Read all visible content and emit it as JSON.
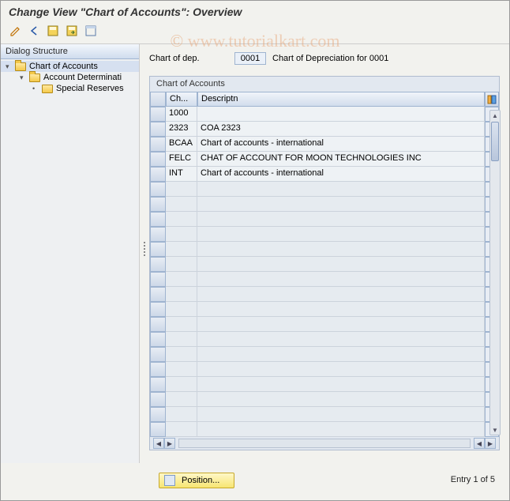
{
  "title": "Change View \"Chart of Accounts\": Overview",
  "watermark": {
    "copyright": "©",
    "text": "www.tutorialkart.com"
  },
  "toolbar": {
    "items": [
      "edit-icon",
      "back-icon",
      "save-icon",
      "save-next-icon",
      "expand-icon"
    ]
  },
  "sidebar": {
    "header": "Dialog Structure",
    "tree": [
      {
        "label": "Chart of Accounts",
        "level": 1,
        "expanded": true,
        "selected": true
      },
      {
        "label": "Account Determinati",
        "level": 2,
        "expanded": true
      },
      {
        "label": "Special Reserves",
        "level": 3,
        "expanded": false,
        "leaf": true
      }
    ]
  },
  "header_field": {
    "label": "Chart of dep.",
    "value": "0001",
    "desc": "Chart of Depreciation for 0001"
  },
  "panel": {
    "title": "Chart of Accounts",
    "columns": [
      {
        "key": "code",
        "label": "Ch..."
      },
      {
        "key": "desc",
        "label": "Descriptn"
      }
    ],
    "rows": [
      {
        "code": "1000",
        "desc": ""
      },
      {
        "code": "2323",
        "desc": "COA 2323"
      },
      {
        "code": "BCAA",
        "desc": "Chart of accounts - international"
      },
      {
        "code": "FELC",
        "desc": "CHAT OF ACCOUNT FOR MOON TECHNOLOGIES INC"
      },
      {
        "code": "INT",
        "desc": "Chart of accounts - international"
      }
    ],
    "empty_rows": 17
  },
  "footer": {
    "position_btn": "Position...",
    "entry_text": "Entry 1 of 5"
  }
}
